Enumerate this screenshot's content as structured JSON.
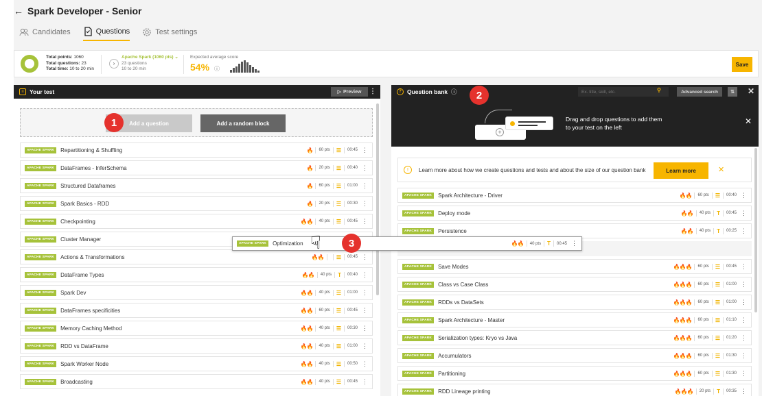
{
  "header": {
    "back_arrow": "←",
    "title": "Spark Developer - Senior"
  },
  "tabs": [
    {
      "label": "Candidates",
      "icon": "users-icon",
      "active": false
    },
    {
      "label": "Questions",
      "icon": "document-icon",
      "active": true
    },
    {
      "label": "Test settings",
      "icon": "gear-icon",
      "active": false
    }
  ],
  "summary": {
    "points_label": "Total points:",
    "points": "1060",
    "questions_label": "Total questions:",
    "questions": "23",
    "time_label": "Total time:",
    "time": "10 to 20 min",
    "skill": "Apache Spark (1060 pts)",
    "skill_questions": "23 questions",
    "skill_time": "10 to 20 min",
    "expected_label": "Expected average score",
    "expected_pct": "54%",
    "save_label": "Save",
    "histogram": [
      4,
      7,
      9,
      13,
      16,
      18,
      15,
      11,
      8,
      5,
      3
    ]
  },
  "left_panel": {
    "title": "Your test",
    "preview_label": "Preview",
    "add_question_label": "Add a question",
    "add_block_label": "Add a random block",
    "rows": [
      {
        "tag": "APACHE SPARK",
        "title": "Repartitioning & Shuffling",
        "flames": "🔥",
        "pts": "60 pts",
        "type_icon": "list-icon",
        "time": "00:45"
      },
      {
        "tag": "APACHE SPARK",
        "title": "DataFrames - InferSchema",
        "flames": "🔥",
        "pts": "20 pts",
        "type_icon": "list-icon",
        "time": "00:40"
      },
      {
        "tag": "APACHE SPARK",
        "title": "Structured Dataframes",
        "flames": "🔥",
        "pts": "60 pts",
        "type_icon": "list-icon",
        "time": "01:00"
      },
      {
        "tag": "APACHE SPARK",
        "title": "Spark Basics - RDD",
        "flames": "🔥",
        "pts": "20 pts",
        "type_icon": "list-icon",
        "time": "00:30"
      },
      {
        "tag": "APACHE SPARK",
        "title": "Checkpointing",
        "flames": "🔥🔥",
        "pts": "40 pts",
        "type_icon": "list-icon",
        "time": "00:45"
      },
      {
        "tag": "APACHE SPARK",
        "title": "Cluster Manager",
        "flames": "🔥🔥",
        "pts": "",
        "type_icon": "list-icon",
        "time": ""
      },
      {
        "tag": "APACHE SPARK",
        "title": "Actions & Transformations",
        "flames": "🔥🔥",
        "pts": "",
        "type_icon": "list-icon",
        "time": "00:45"
      },
      {
        "tag": "APACHE SPARK",
        "title": "DataFrame Types",
        "flames": "🔥🔥",
        "pts": "40 pts",
        "type_icon": "text-icon",
        "time": "00:40"
      },
      {
        "tag": "APACHE SPARK",
        "title": "Spark Dev",
        "flames": "🔥🔥",
        "pts": "40 pts",
        "type_icon": "list-icon",
        "time": "01:00"
      },
      {
        "tag": "APACHE SPARK",
        "title": "DataFrames specificities",
        "flames": "🔥🔥",
        "pts": "60 pts",
        "type_icon": "list-icon",
        "time": "00:45"
      },
      {
        "tag": "APACHE SPARK",
        "title": "Memory Caching Method",
        "flames": "🔥🔥",
        "pts": "40 pts",
        "type_icon": "list-icon",
        "time": "00:30"
      },
      {
        "tag": "APACHE SPARK",
        "title": "RDD vs DataFrame",
        "flames": "🔥🔥",
        "pts": "40 pts",
        "type_icon": "list-icon",
        "time": "01:00"
      },
      {
        "tag": "APACHE SPARK",
        "title": "Spark Worker Node",
        "flames": "🔥🔥",
        "pts": "40 pts",
        "type_icon": "list-icon",
        "time": "00:50"
      },
      {
        "tag": "APACHE SPARK",
        "title": "Broadcasting",
        "flames": "🔥🔥",
        "pts": "40 pts",
        "type_icon": "list-icon",
        "time": "00:45"
      }
    ]
  },
  "right_panel": {
    "title": "Question bank",
    "search_placeholder": "Ex. title, skill, etc.",
    "advanced_label": "Advanced search",
    "dnd_line1": "Drag and drop questions to add them",
    "dnd_line2": "to your test on the left",
    "learn_text": "Learn more about how we create questions and tests and about the size of our question bank",
    "learn_btn": "Learn more",
    "rows_top": [
      {
        "tag": "APACHE SPARK",
        "title": "Spark Architecture - Driver",
        "flames": "🔥🔥",
        "pts": "60 pts",
        "type_icon": "list-icon",
        "time": "00:40"
      },
      {
        "tag": "APACHE SPARK",
        "title": "Deploy mode",
        "flames": "🔥🔥",
        "pts": "40 pts",
        "type_icon": "text-icon",
        "time": "00:45"
      },
      {
        "tag": "APACHE SPARK",
        "title": "Persistence",
        "flames": "🔥🔥",
        "pts": "40 pts",
        "type_icon": "text-icon",
        "time": "00:25"
      }
    ],
    "rows_bottom": [
      {
        "tag": "APACHE SPARK",
        "title": "Save Modes",
        "flames": "🔥🔥🔥",
        "pts": "60 pts",
        "type_icon": "list-icon",
        "time": "00:45"
      },
      {
        "tag": "APACHE SPARK",
        "title": "Class vs Case Class",
        "flames": "🔥🔥🔥",
        "pts": "60 pts",
        "type_icon": "list-icon",
        "time": "01:00"
      },
      {
        "tag": "APACHE SPARK",
        "title": "RDDs vs DataSets",
        "flames": "🔥🔥🔥",
        "pts": "60 pts",
        "type_icon": "list-icon",
        "time": "01:00"
      },
      {
        "tag": "APACHE SPARK",
        "title": "Spark Architecture - Master",
        "flames": "🔥🔥🔥",
        "pts": "60 pts",
        "type_icon": "list-icon",
        "time": "01:10"
      },
      {
        "tag": "APACHE SPARK",
        "title": "Serialization types: Kryo vs Java",
        "flames": "🔥🔥🔥",
        "pts": "60 pts",
        "type_icon": "list-icon",
        "time": "01:20"
      },
      {
        "tag": "APACHE SPARK",
        "title": "Accumulators",
        "flames": "🔥🔥🔥",
        "pts": "60 pts",
        "type_icon": "list-icon",
        "time": "01:30"
      },
      {
        "tag": "APACHE SPARK",
        "title": "Partitioning",
        "flames": "🔥🔥🔥",
        "pts": "60 pts",
        "type_icon": "list-icon",
        "time": "01:30"
      },
      {
        "tag": "APACHE SPARK",
        "title": "RDD Lineage printing",
        "flames": "🔥🔥🔥",
        "pts": "20 pts",
        "type_icon": "text-icon",
        "time": "00:35"
      }
    ]
  },
  "dragging": {
    "tag": "APACHE SPARK",
    "title": "Optimization",
    "flames": "🔥🔥",
    "pts": "40 pts",
    "type_icon": "text-icon",
    "time": "00:45"
  },
  "badges": [
    "1",
    "2",
    "3"
  ],
  "colors": {
    "accent": "#f7b500",
    "tag_green": "#a6c23a",
    "dark": "#222222",
    "badge_red": "#e5322d"
  }
}
